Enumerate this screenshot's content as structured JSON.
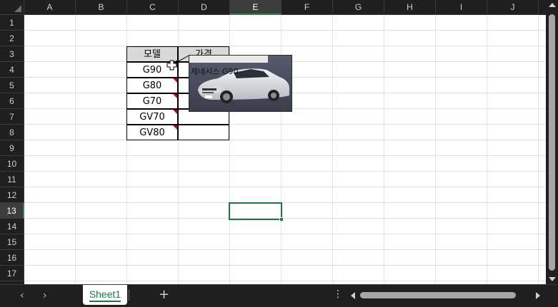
{
  "columns": [
    "A",
    "B",
    "C",
    "D",
    "E",
    "F",
    "G",
    "H",
    "I",
    "J"
  ],
  "selected_column": "E",
  "rows": [
    "1",
    "2",
    "3",
    "4",
    "5",
    "6",
    "7",
    "8",
    "9",
    "10",
    "11",
    "12",
    "13",
    "14",
    "15",
    "16",
    "17"
  ],
  "selected_row": "13",
  "table": {
    "headers": [
      "모델",
      "가격"
    ],
    "models": [
      "G90",
      "G80",
      "G70",
      "GV70",
      "GV80"
    ]
  },
  "comment": {
    "text": "제네시스 G90"
  },
  "sheets": {
    "tabs": [
      "Sheet1"
    ],
    "add_label": "+",
    "more_label": "⋮",
    "prev_label": "‹",
    "next_label": "›"
  },
  "colors": {
    "accent": "#217346",
    "header_fill": "#d9d9d9",
    "comment_indicator": "#d00000",
    "selected_header": "#3d3d3d"
  },
  "icons": {
    "cursor": "cross-select-cursor-icon",
    "select_all": "select-all-triangle-icon"
  }
}
